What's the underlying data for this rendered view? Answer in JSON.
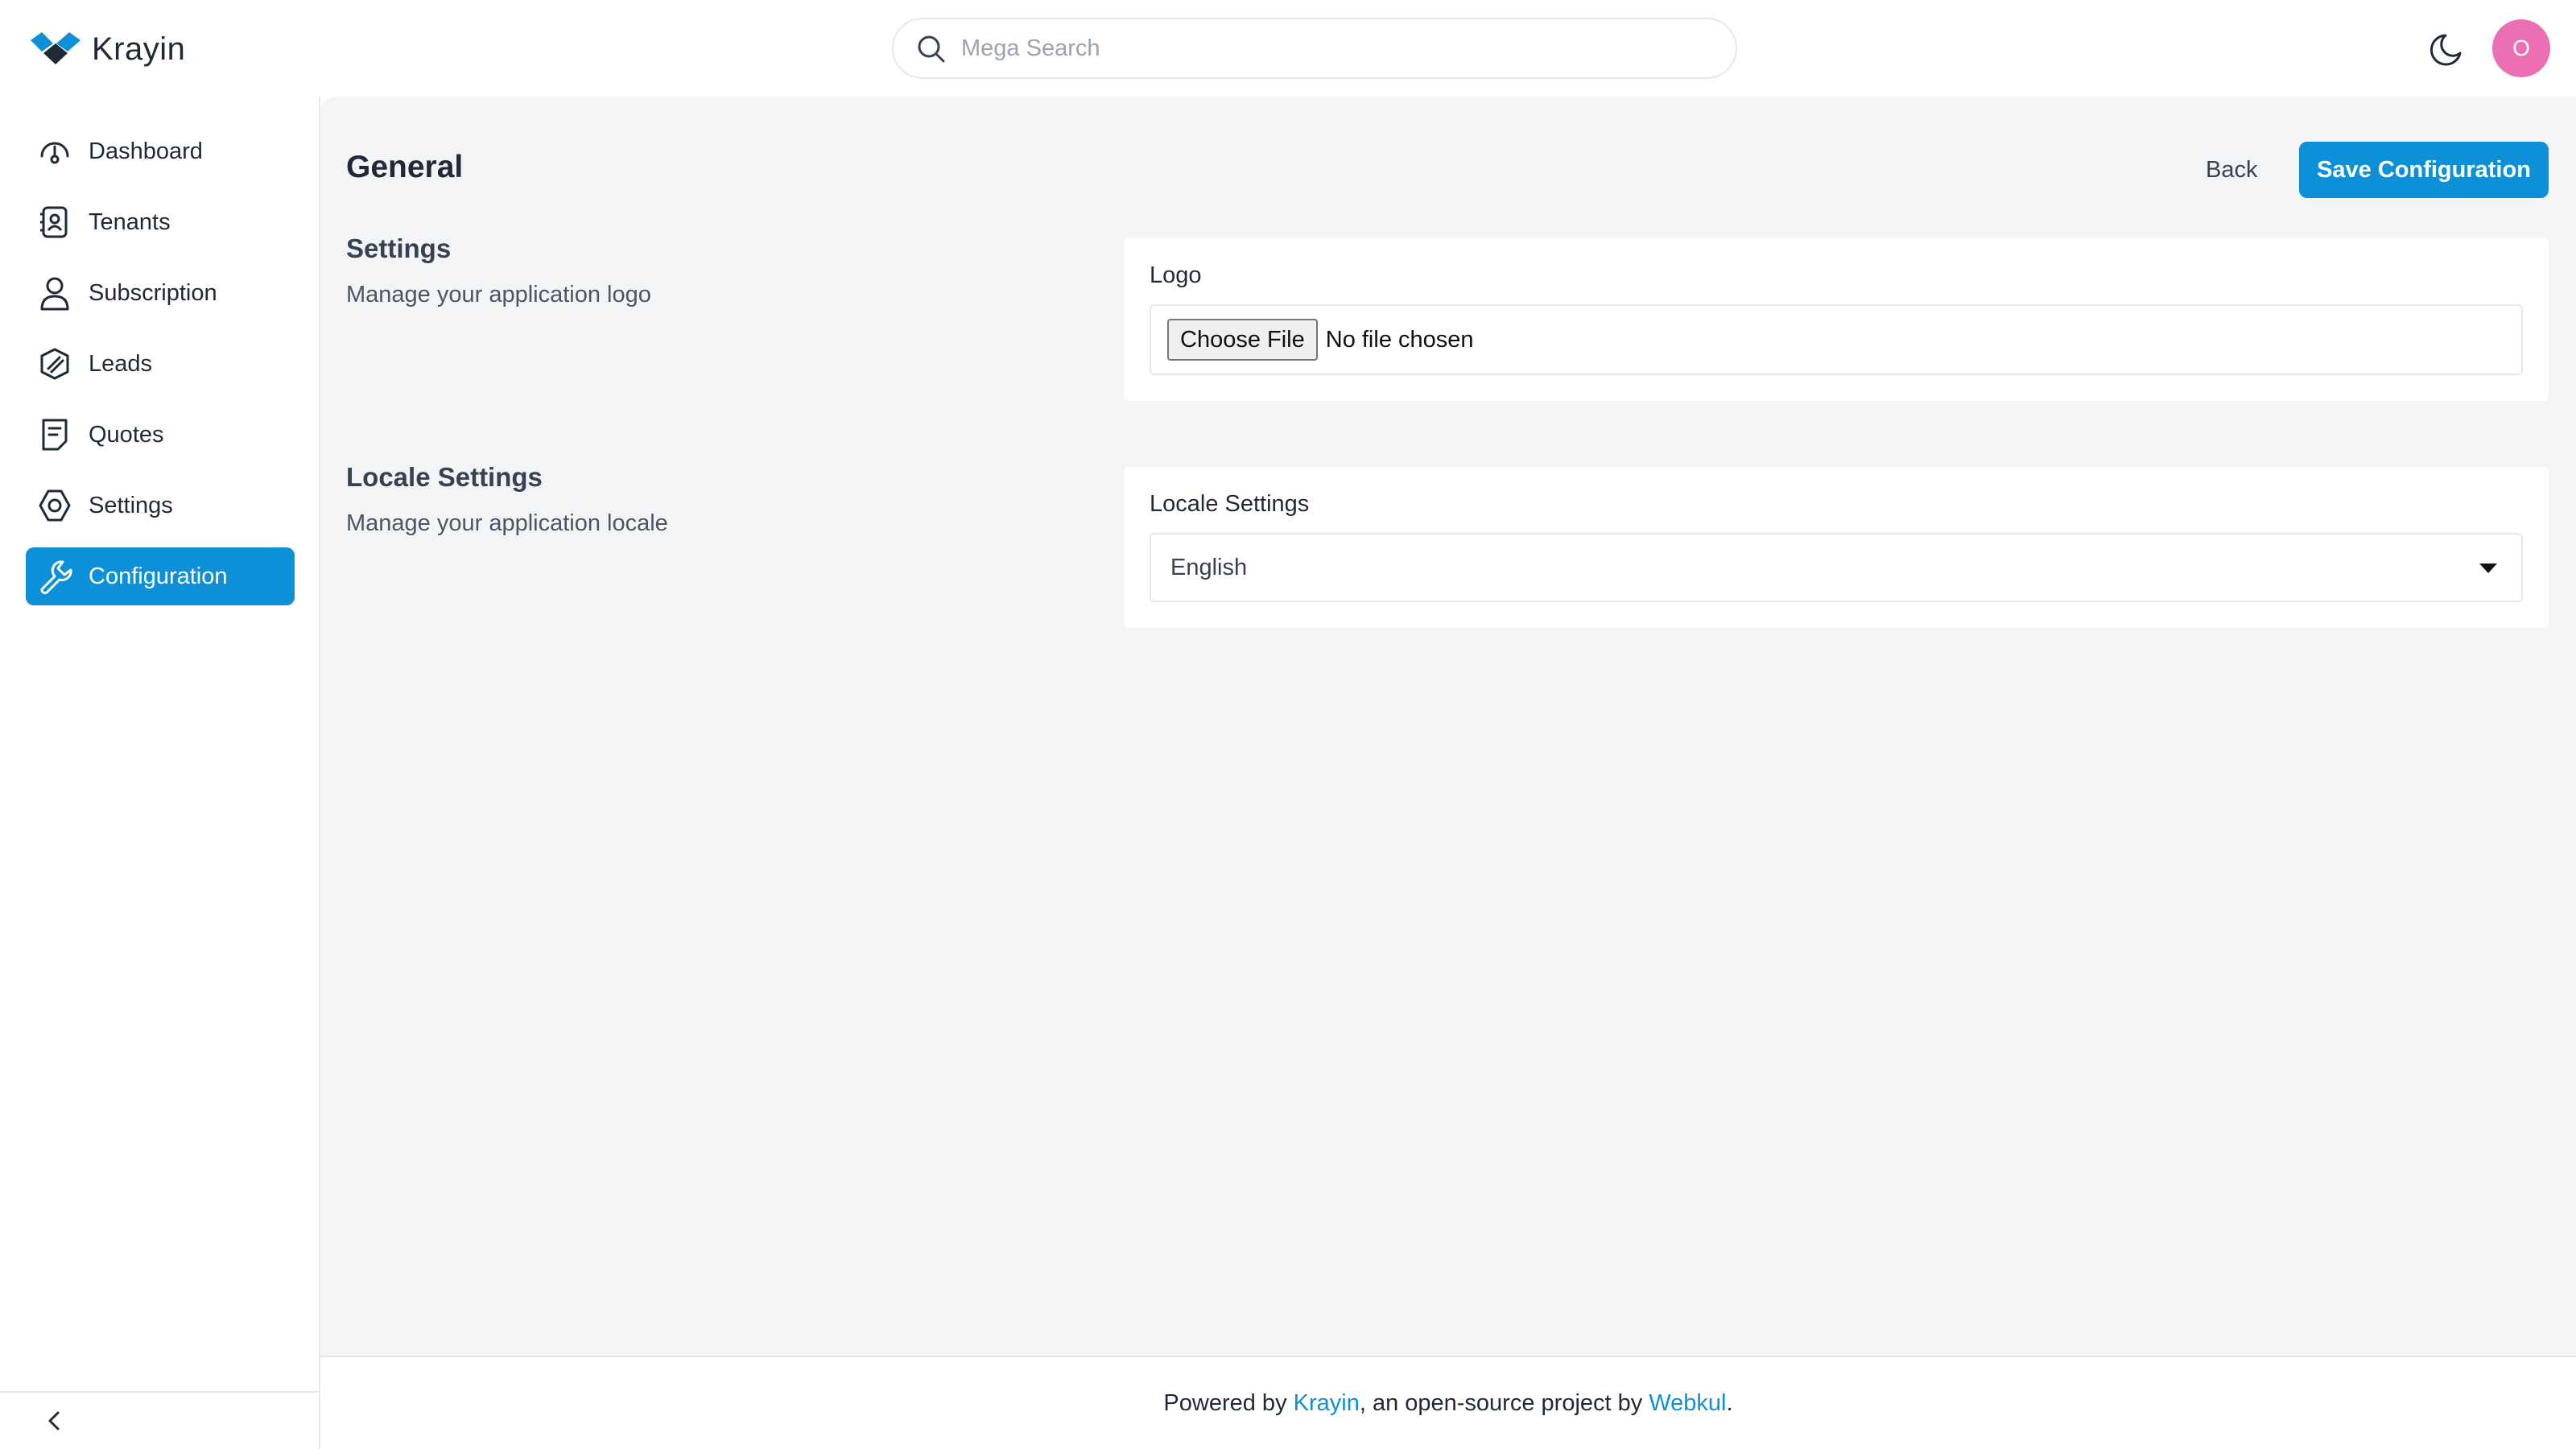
{
  "app": {
    "brand_name": "Krayin"
  },
  "header": {
    "search_placeholder": "Mega Search",
    "avatar_initial": "O"
  },
  "sidebar": {
    "items": [
      {
        "label": "Dashboard",
        "icon": "dashboard-icon"
      },
      {
        "label": "Tenants",
        "icon": "tenants-icon"
      },
      {
        "label": "Subscription",
        "icon": "user-icon"
      },
      {
        "label": "Leads",
        "icon": "leads-icon"
      },
      {
        "label": "Quotes",
        "icon": "quotes-icon"
      },
      {
        "label": "Settings",
        "icon": "settings-icon"
      },
      {
        "label": "Configuration",
        "icon": "wrench-icon",
        "active": true
      }
    ]
  },
  "main": {
    "title": "General",
    "back_label": "Back",
    "save_label": "Save Configuration",
    "sections": [
      {
        "title": "Settings",
        "description": "Manage your application logo",
        "field_label": "Logo",
        "choose_file_label": "Choose File",
        "file_status": "No file chosen"
      },
      {
        "title": "Locale Settings",
        "description": "Manage your application locale",
        "field_label": "Locale Settings",
        "selected_value": "English"
      }
    ]
  },
  "footer": {
    "prefix": "Powered by ",
    "link1": "Krayin",
    "middle": ", an open-source project by ",
    "link2": "Webkul",
    "suffix": "."
  },
  "colors": {
    "accent": "#0e90d9",
    "avatar": "#ec6fb4",
    "main_bg": "#f3f4f6"
  }
}
